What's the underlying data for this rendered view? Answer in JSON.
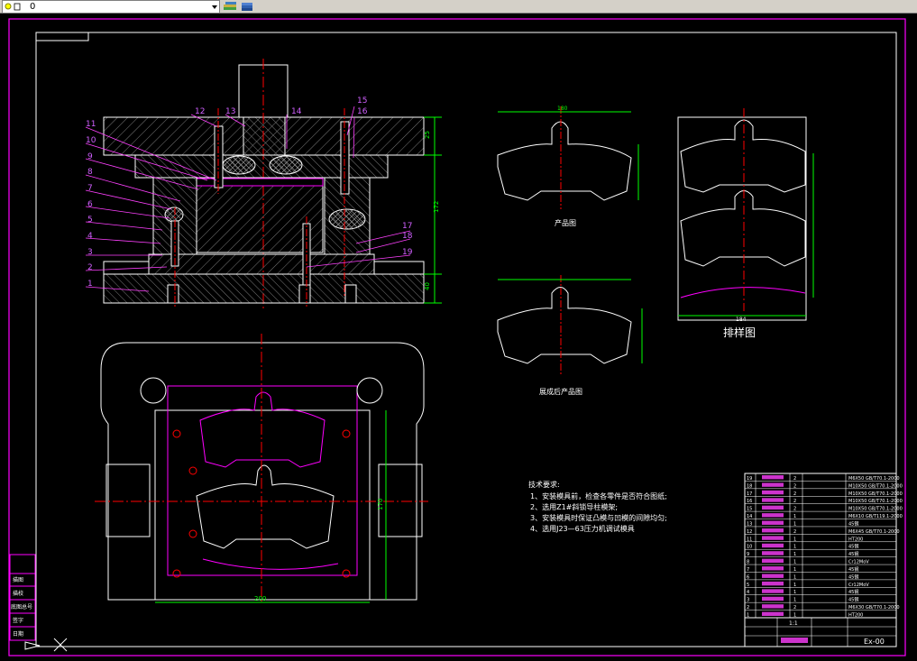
{
  "toolbar": {
    "layer_name": "0",
    "layer_icon": "layer-bulb-icon",
    "layer_buttons": [
      "layer-states-icon",
      "layers-manager-icon"
    ]
  },
  "colors": {
    "background": "#000000",
    "frame": "#ff00ff",
    "outline": "#ffffff",
    "center": "#ff0000",
    "dimension": "#00ff00",
    "hatch": "#808080",
    "label": "#d060ff"
  },
  "drawing": {
    "part_labels": [
      "1",
      "2",
      "3",
      "4",
      "5",
      "6",
      "7",
      "8",
      "9",
      "10",
      "11",
      "12",
      "13",
      "14",
      "15",
      "16",
      "17",
      "18",
      "19"
    ],
    "dim_labels": {
      "height_total": "172",
      "height_top": "25",
      "height_bottom": "40",
      "plan_width": "200",
      "plan_height": "170",
      "blank_width": "180",
      "strip_width": "184"
    },
    "product_caption": "产品图",
    "developed_caption": "展成后产品图",
    "layout_caption": "排样图",
    "technical_requirements": {
      "title": "技术要求:",
      "items": [
        "1、安装模具前，检查各零件是否符合图纸;",
        "2、选用Z1#斜锁导柱模架;",
        "3、安装模具时保证凸模与凹模的间隙均匀;",
        "4、选用J23—63压力机调试模具"
      ]
    },
    "bom_rows": [
      {
        "no": "19",
        "qty": "2",
        "spec": "M6X50 GB/T70.1-2000"
      },
      {
        "no": "18",
        "qty": "2",
        "spec": "M10X50 GB/T70.1-2000"
      },
      {
        "no": "17",
        "qty": "2",
        "spec": "M10X50 GB/T70.1-2000"
      },
      {
        "no": "16",
        "qty": "2",
        "spec": "M10X50 GB/T70.1-2000"
      },
      {
        "no": "15",
        "qty": "2",
        "spec": "M10X50 GB/T70.1-2000"
      },
      {
        "no": "14",
        "qty": "1",
        "spec": "M6X10 GB/T119.1-2000"
      },
      {
        "no": "13",
        "qty": "1",
        "spec": "45钢"
      },
      {
        "no": "12",
        "qty": "2",
        "spec": "M6X45 GB/T70.1-2000"
      },
      {
        "no": "11",
        "qty": "1",
        "spec": "HT200"
      },
      {
        "no": "10",
        "qty": "1",
        "spec": "45钢"
      },
      {
        "no": "9",
        "qty": "1",
        "spec": "45钢"
      },
      {
        "no": "8",
        "qty": "1",
        "spec": "Cr12MoV"
      },
      {
        "no": "7",
        "qty": "1",
        "spec": "45钢"
      },
      {
        "no": "6",
        "qty": "1",
        "spec": "45钢"
      },
      {
        "no": "5",
        "qty": "1",
        "spec": "Cr12MoV"
      },
      {
        "no": "4",
        "qty": "1",
        "spec": "45钢"
      },
      {
        "no": "3",
        "qty": "1",
        "spec": "45钢"
      },
      {
        "no": "2",
        "qty": "2",
        "spec": "M6X30 GB/T70.1-2000"
      },
      {
        "no": "1",
        "qty": "1",
        "spec": "HT200"
      }
    ],
    "title_block": {
      "scale": "1:1",
      "drawing_no": "Ex-00"
    },
    "left_stamp": [
      "描图",
      "描校",
      "底图总号",
      "签字",
      "日期"
    ]
  }
}
